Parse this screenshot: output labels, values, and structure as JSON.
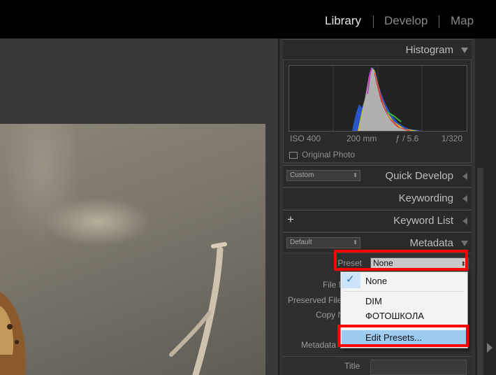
{
  "modules": {
    "library": "Library",
    "develop": "Develop",
    "map": "Map"
  },
  "panels": {
    "histogram": "Histogram",
    "quick_develop": "Quick Develop",
    "quick_develop_preset": "Custom",
    "keywording": "Keywording",
    "keyword_list": "Keyword List",
    "keyword_list_add": "+",
    "metadata": "Metadata",
    "metadata_set": "Default"
  },
  "histogram": {
    "iso": "ISO 400",
    "focal": "200 mm",
    "aperture": "ƒ / 5.6",
    "shutter": "1/320",
    "original_photo": "Original Photo"
  },
  "metadata": {
    "preset_label": "Preset",
    "preset_value": "None",
    "file_label": "File N",
    "preserved_label": "Preserved File",
    "copy_label": "Copy N",
    "metadata_label": "Metadata",
    "title_label": "Title"
  },
  "dropdown": {
    "items": [
      "None",
      "DIM",
      "ФОТОШКОЛА",
      "Edit Presets..."
    ],
    "selected": "None"
  },
  "colors": {
    "highlight_box": "#ff0000",
    "menu_selection": "#9ecbf2"
  }
}
